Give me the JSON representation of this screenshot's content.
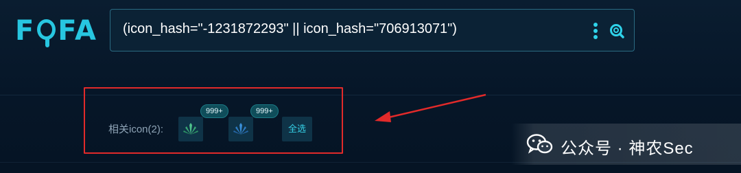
{
  "logo": {
    "text_left": "F",
    "text_right": "FA"
  },
  "search": {
    "query": "(icon_hash=\"-1231872293\" || icon_hash=\"706913071\")"
  },
  "related": {
    "label": "相关icon(2):",
    "icons": [
      {
        "badge": "999+",
        "icon": "agave-plant-icon",
        "color": "#4fc28c"
      },
      {
        "badge": "999+",
        "icon": "agave-plant-icon",
        "color": "#3a8fd8"
      }
    ],
    "select_all_label": "全选"
  },
  "annotation": {
    "highlight_color": "#e22a2a"
  },
  "watermark": {
    "text": "公众号 · 神农Sec"
  }
}
